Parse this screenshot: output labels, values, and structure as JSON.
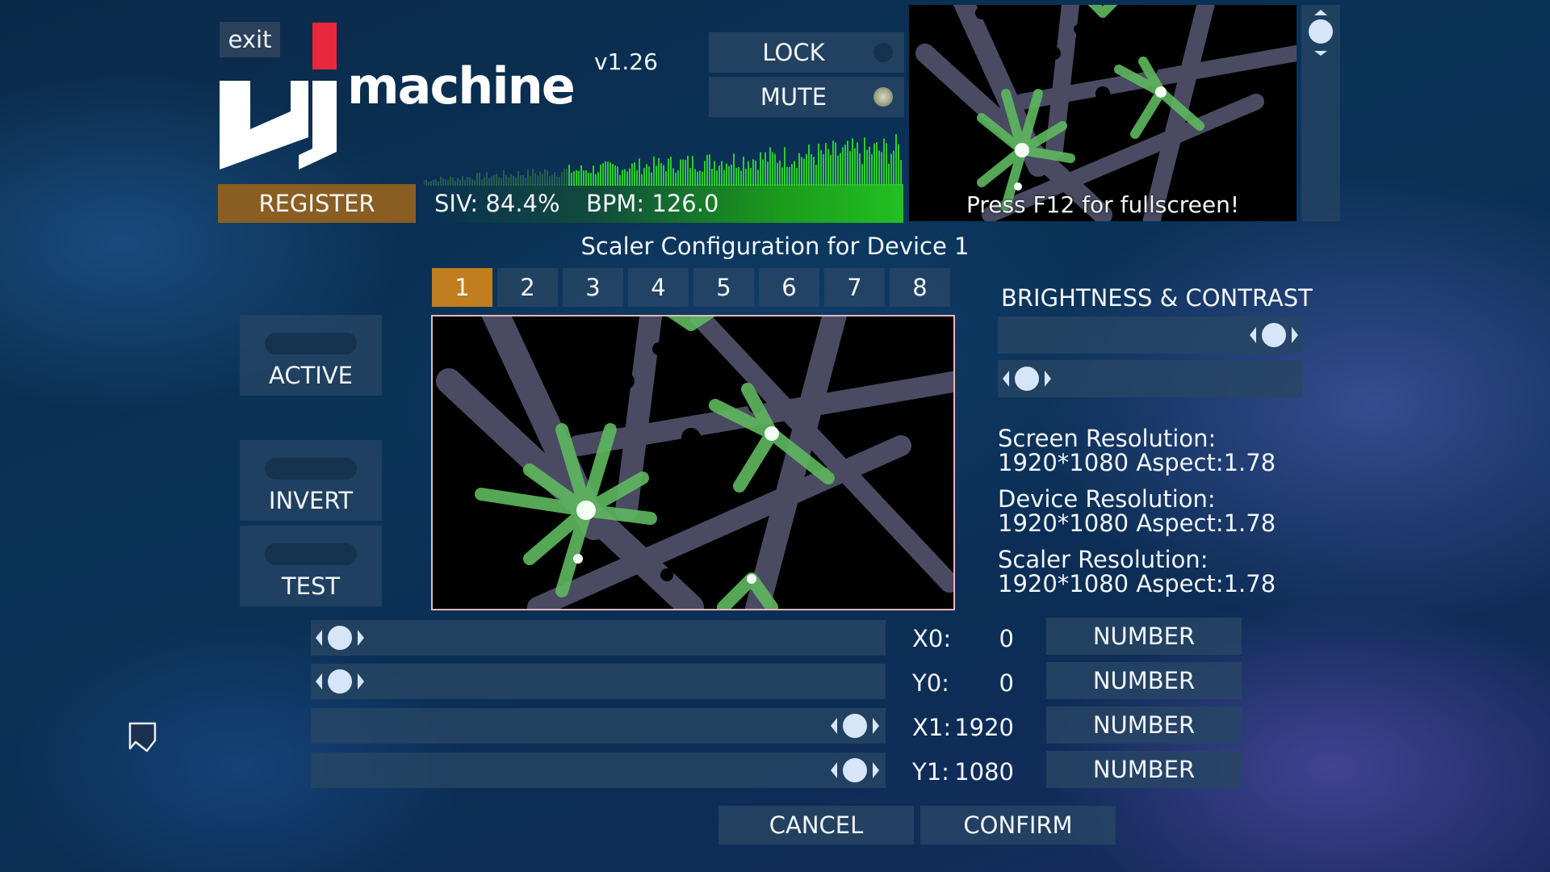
{
  "header": {
    "exit_label": "exit",
    "version": "v1.26",
    "lock_label": "LOCK",
    "mute_label": "MUTE",
    "register_label": "REGISTER",
    "siv": "SIV: 84.4%",
    "bpm": "BPM: 126.0",
    "fullscreen_hint": "Press F12 for fullscreen!"
  },
  "title": "Scaler Configuration for Device 1",
  "tabs": [
    "1",
    "2",
    "3",
    "4",
    "5",
    "6",
    "7",
    "8"
  ],
  "active_tab": "1",
  "toggles": {
    "active": "ACTIVE",
    "invert": "INVERT",
    "test": "TEST"
  },
  "brightness_contrast": {
    "title": "BRIGHTNESS & CONTRAST"
  },
  "resolution": {
    "screen_label": "Screen Resolution:",
    "screen_value": "1920*1080 Aspect:1.78",
    "device_label": "Device Resolution:",
    "device_value": "1920*1080 Aspect:1.78",
    "scaler_label": "Scaler Resolution:",
    "scaler_value": "1920*1080 Aspect:1.78"
  },
  "coords": [
    {
      "label": "X0:",
      "value": "0",
      "button": "NUMBER"
    },
    {
      "label": "Y0:",
      "value": "0",
      "button": "NUMBER"
    },
    {
      "label": "X1:",
      "value": "1920",
      "button": "NUMBER"
    },
    {
      "label": "Y1:",
      "value": "1080",
      "button": "NUMBER"
    }
  ],
  "footer": {
    "cancel_label": "CANCEL",
    "confirm_label": "CONFIRM"
  },
  "colors": {
    "accent_orange": "#c07e1e",
    "register_brown": "#8a5e22",
    "logo_red": "#e8283c",
    "audio_green": "#22c022"
  },
  "icons": [
    "exit",
    "logo",
    "lock-led",
    "mute-led",
    "slider-knob",
    "scroll-knob",
    "tag-icon"
  ]
}
